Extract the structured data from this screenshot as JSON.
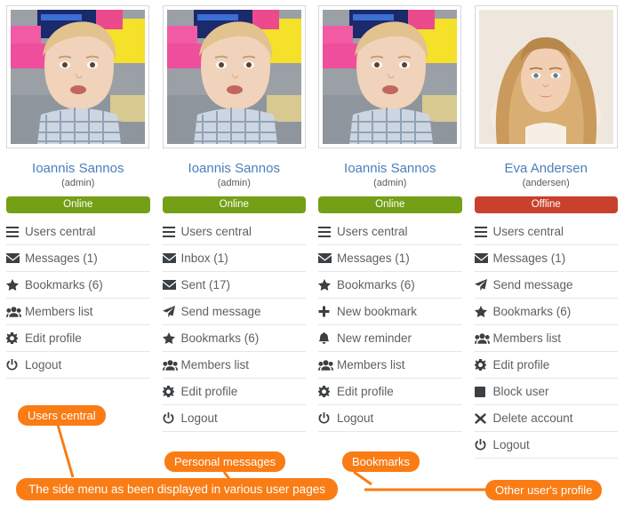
{
  "page": {
    "accent_orange": "#f97c14",
    "online_color": "#74a017",
    "offline_color": "#c9412d",
    "name_link_color": "#4a7ebb"
  },
  "columns": [
    {
      "avatar_name": "toddler-photo",
      "name": "Ioannis Sannos",
      "login": "(admin)",
      "status": {
        "label": "Online",
        "state": "online"
      },
      "menu": [
        {
          "icon": "bars-icon",
          "label": "Users central"
        },
        {
          "icon": "envelope-icon",
          "label": "Messages (1)"
        },
        {
          "icon": "star-icon",
          "label": "Bookmarks (6)"
        },
        {
          "icon": "users-icon",
          "label": "Members list"
        },
        {
          "icon": "gear-icon",
          "label": "Edit profile"
        },
        {
          "icon": "power-off-icon",
          "label": "Logout"
        }
      ]
    },
    {
      "avatar_name": "toddler-photo",
      "name": "Ioannis Sannos",
      "login": "(admin)",
      "status": {
        "label": "Online",
        "state": "online"
      },
      "menu": [
        {
          "icon": "bars-icon",
          "label": "Users central"
        },
        {
          "icon": "envelope-icon",
          "label": "Inbox (1)"
        },
        {
          "icon": "envelope-icon",
          "label": "Sent (17)"
        },
        {
          "icon": "paper-plane-icon",
          "label": "Send message"
        },
        {
          "icon": "star-icon",
          "label": "Bookmarks (6)"
        },
        {
          "icon": "users-icon",
          "label": "Members list"
        },
        {
          "icon": "gear-icon",
          "label": "Edit profile"
        },
        {
          "icon": "power-off-icon",
          "label": "Logout"
        }
      ]
    },
    {
      "avatar_name": "toddler-photo",
      "name": "Ioannis Sannos",
      "login": "(admin)",
      "status": {
        "label": "Online",
        "state": "online"
      },
      "menu": [
        {
          "icon": "bars-icon",
          "label": "Users central"
        },
        {
          "icon": "envelope-icon",
          "label": "Messages (1)"
        },
        {
          "icon": "star-icon",
          "label": "Bookmarks (6)"
        },
        {
          "icon": "plus-icon",
          "label": "New bookmark"
        },
        {
          "icon": "bell-icon",
          "label": "New reminder"
        },
        {
          "icon": "users-icon",
          "label": "Members list"
        },
        {
          "icon": "gear-icon",
          "label": "Edit profile"
        },
        {
          "icon": "power-off-icon",
          "label": "Logout"
        }
      ]
    },
    {
      "avatar_name": "woman-photo",
      "name": "Eva Andersen",
      "login": "(andersen)",
      "status": {
        "label": "Offline",
        "state": "offline"
      },
      "menu": [
        {
          "icon": "bars-icon",
          "label": "Users central"
        },
        {
          "icon": "envelope-icon",
          "label": "Messages (1)"
        },
        {
          "icon": "paper-plane-icon",
          "label": "Send message"
        },
        {
          "icon": "star-icon",
          "label": "Bookmarks (6)"
        },
        {
          "icon": "users-icon",
          "label": "Members list"
        },
        {
          "icon": "gear-icon",
          "label": "Edit profile"
        },
        {
          "icon": "ban-icon",
          "label": "Block user"
        },
        {
          "icon": "times-icon",
          "label": "Delete account"
        },
        {
          "icon": "power-off-icon",
          "label": "Logout"
        }
      ]
    }
  ],
  "annotations": {
    "users_central": "Users central",
    "personal_messages": "Personal messages",
    "bookmarks": "Bookmarks",
    "other_user_profile": "Other user's profile",
    "caption": "The side menu as been displayed in various user pages"
  }
}
